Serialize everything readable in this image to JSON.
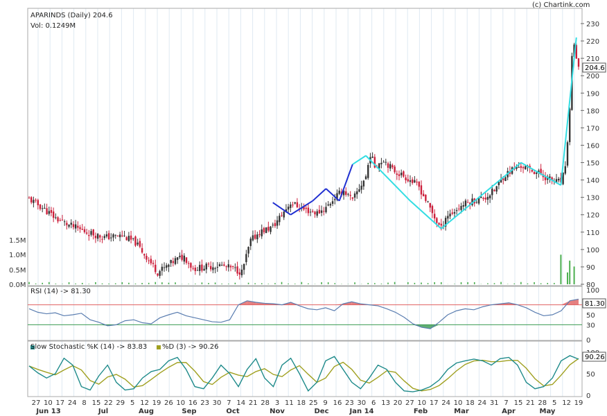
{
  "header": {
    "title": "APARINDS (Daily) 204.6",
    "volume": "Vol: 0.1249M",
    "credit": "(c) Chartink.com"
  },
  "colors": {
    "up": "#333333",
    "down": "#cc1f3b",
    "grid": "#dfe9f2",
    "zigzag_dark": "#1f2fd1",
    "zigzag_light": "#33dde3",
    "volume": "#4caf50",
    "rsi_line": "#5a7db0",
    "rsi_over": "#e06060",
    "rsi_under": "#3a9a50",
    "stoch_k": "#1f8b8b",
    "stoch_d": "#a0a020"
  },
  "price_panel": {
    "current_value": "204.6",
    "y_ticks": [
      80,
      90,
      100,
      110,
      120,
      130,
      140,
      150,
      160,
      170,
      180,
      190,
      200,
      210,
      220,
      230
    ],
    "volume_ticks": [
      "1.5M",
      "1.0M",
      "0.5M",
      "0.0M"
    ]
  },
  "rsi_panel": {
    "label": "RSI (14) -> 81.30",
    "current_value": "81.30",
    "levels": [
      70,
      30
    ],
    "y_ticks": [
      0,
      30,
      50,
      70,
      100
    ]
  },
  "stoch_panel": {
    "label_k": "Slow Stochastic %K (14) -> 83.83",
    "label_d": "%D (3) -> 90.26",
    "current_value": "90.26",
    "y_ticks": [
      0,
      50,
      100
    ]
  },
  "x_axis": {
    "day_labels": [
      "27",
      "10",
      "17",
      "24",
      "8",
      "15",
      "22",
      "29",
      "5",
      "12",
      "19",
      "26",
      "10",
      "16",
      "23",
      "30",
      "7",
      "14",
      "21",
      "28",
      "3",
      "11",
      "18",
      "25",
      "9",
      "16",
      "23",
      "30",
      "6",
      "13",
      "20",
      "27",
      "10",
      "17",
      "24",
      "10",
      "18",
      "24",
      "31",
      "7",
      "15",
      "21",
      "28",
      "5",
      "12",
      "19"
    ],
    "month_labels": [
      "Jun 13",
      "Jul",
      "Aug",
      "Sep",
      "Oct",
      "Nov",
      "Dec",
      "Jan 14",
      "Feb",
      "Mar",
      "Apr",
      "May"
    ]
  },
  "chart_data": {
    "type": "candlestick",
    "title": "APARINDS (Daily) 204.6",
    "ylim": [
      80,
      230
    ],
    "price_path": [
      {
        "x": 0,
        "y": 129
      },
      {
        "x": 6,
        "y": 124
      },
      {
        "x": 12,
        "y": 118
      },
      {
        "x": 18,
        "y": 114
      },
      {
        "x": 26,
        "y": 110
      },
      {
        "x": 34,
        "y": 107
      },
      {
        "x": 42,
        "y": 108
      },
      {
        "x": 48,
        "y": 104
      },
      {
        "x": 54,
        "y": 94
      },
      {
        "x": 58,
        "y": 87
      },
      {
        "x": 62,
        "y": 90
      },
      {
        "x": 66,
        "y": 94
      },
      {
        "x": 70,
        "y": 96
      },
      {
        "x": 74,
        "y": 89
      },
      {
        "x": 80,
        "y": 90
      },
      {
        "x": 86,
        "y": 91
      },
      {
        "x": 92,
        "y": 89
      },
      {
        "x": 96,
        "y": 87
      },
      {
        "x": 98,
        "y": 96
      },
      {
        "x": 100,
        "y": 105
      },
      {
        "x": 104,
        "y": 110
      },
      {
        "x": 110,
        "y": 113
      },
      {
        "x": 114,
        "y": 120
      },
      {
        "x": 118,
        "y": 127
      },
      {
        "x": 124,
        "y": 123
      },
      {
        "x": 130,
        "y": 121
      },
      {
        "x": 134,
        "y": 124
      },
      {
        "x": 138,
        "y": 130
      },
      {
        "x": 142,
        "y": 134
      },
      {
        "x": 146,
        "y": 128
      },
      {
        "x": 148,
        "y": 133
      },
      {
        "x": 152,
        "y": 142
      },
      {
        "x": 154,
        "y": 155
      },
      {
        "x": 156,
        "y": 148
      },
      {
        "x": 160,
        "y": 152
      },
      {
        "x": 164,
        "y": 146
      },
      {
        "x": 168,
        "y": 143
      },
      {
        "x": 172,
        "y": 140
      },
      {
        "x": 176,
        "y": 136
      },
      {
        "x": 180,
        "y": 126
      },
      {
        "x": 184,
        "y": 116
      },
      {
        "x": 186,
        "y": 112
      },
      {
        "x": 188,
        "y": 119
      },
      {
        "x": 192,
        "y": 122
      },
      {
        "x": 196,
        "y": 126
      },
      {
        "x": 200,
        "y": 128
      },
      {
        "x": 206,
        "y": 130
      },
      {
        "x": 210,
        "y": 134
      },
      {
        "x": 214,
        "y": 142
      },
      {
        "x": 218,
        "y": 146
      },
      {
        "x": 222,
        "y": 148
      },
      {
        "x": 226,
        "y": 146
      },
      {
        "x": 230,
        "y": 144
      },
      {
        "x": 234,
        "y": 141
      },
      {
        "x": 238,
        "y": 139
      },
      {
        "x": 240,
        "y": 139
      },
      {
        "x": 242,
        "y": 146
      },
      {
        "x": 244,
        "y": 180
      },
      {
        "x": 245,
        "y": 212
      },
      {
        "x": 246,
        "y": 218
      },
      {
        "x": 247,
        "y": 208
      },
      {
        "x": 248,
        "y": 204.6
      }
    ],
    "volume_spikes": [
      {
        "x": 240,
        "y": 1.0
      },
      {
        "x": 244,
        "y": 0.8
      },
      {
        "x": 246,
        "y": 0.6
      },
      {
        "x": 243,
        "y": 0.4
      }
    ],
    "zigzag": [
      {
        "x": 110,
        "y": 127,
        "c": "dark"
      },
      {
        "x": 118,
        "y": 120,
        "c": "dark"
      },
      {
        "x": 128,
        "y": 128,
        "c": "dark"
      },
      {
        "x": 134,
        "y": 135,
        "c": "dark"
      },
      {
        "x": 140,
        "y": 128,
        "c": "dark"
      },
      {
        "x": 146,
        "y": 149,
        "c": "dark"
      },
      {
        "x": 152,
        "y": 154,
        "c": "light"
      },
      {
        "x": 172,
        "y": 128,
        "c": "light"
      },
      {
        "x": 186,
        "y": 112,
        "c": "light"
      },
      {
        "x": 222,
        "y": 150,
        "c": "light"
      },
      {
        "x": 240,
        "y": 137,
        "c": "light"
      },
      {
        "x": 247,
        "y": 222,
        "c": "light"
      }
    ],
    "rsi": [
      62,
      55,
      52,
      54,
      48,
      50,
      53,
      40,
      35,
      28,
      30,
      38,
      40,
      34,
      32,
      44,
      50,
      55,
      48,
      44,
      40,
      36,
      35,
      40,
      70,
      78,
      75,
      73,
      72,
      70,
      75,
      68,
      62,
      60,
      64,
      58,
      72,
      76,
      72,
      70,
      68,
      62,
      55,
      45,
      32,
      25,
      22,
      35,
      50,
      58,
      62,
      60,
      66,
      70,
      72,
      74,
      70,
      64,
      55,
      48,
      50,
      58,
      78,
      81.3
    ],
    "stoch_k": [
      68,
      52,
      40,
      50,
      86,
      70,
      20,
      12,
      45,
      70,
      30,
      12,
      15,
      40,
      55,
      60,
      80,
      88,
      60,
      20,
      15,
      40,
      70,
      50,
      20,
      60,
      85,
      40,
      20,
      70,
      86,
      50,
      10,
      30,
      80,
      90,
      60,
      30,
      15,
      40,
      70,
      60,
      30,
      10,
      8,
      12,
      20,
      35,
      60,
      75,
      80,
      84,
      80,
      70,
      85,
      88,
      70,
      30,
      15,
      20,
      40,
      80,
      92,
      83.83
    ]
  }
}
